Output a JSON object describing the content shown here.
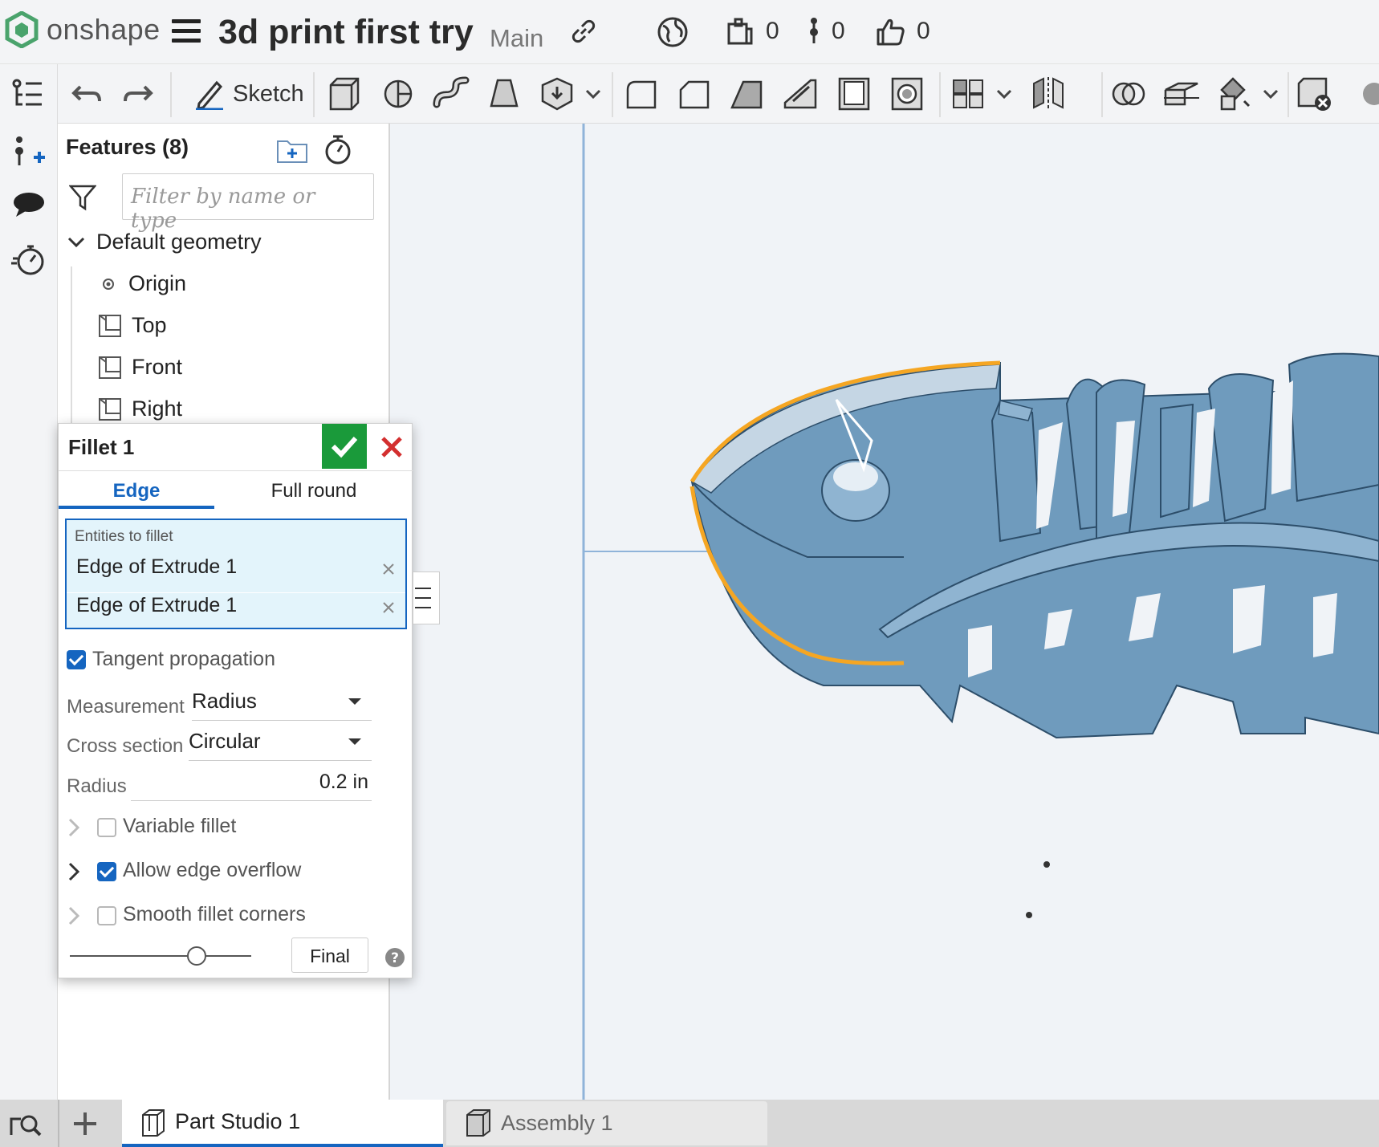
{
  "brand": {
    "name": "onshape",
    "color": "#4aa36c"
  },
  "document": {
    "title": "3d print first try",
    "branch": "Main"
  },
  "counters": {
    "versions": "0",
    "branches": "0",
    "likes": "0"
  },
  "toolbar": {
    "sketch_label": "Sketch"
  },
  "features": {
    "title": "Features (8)",
    "filter_placeholder": "Filter by name or type",
    "default_geometry": "Default geometry",
    "items": [
      "Origin",
      "Top",
      "Front",
      "Right"
    ]
  },
  "fillet": {
    "title": "Fillet 1",
    "tabs": [
      "Edge",
      "Full round"
    ],
    "entities_label": "Entities to fillet",
    "entities": [
      "Edge of Extrude 1",
      "Edge of Extrude 1"
    ],
    "tangent_propagation": "Tangent propagation",
    "measurement_label": "Measurement",
    "measurement_value": "Radius",
    "cross_section_label": "Cross section",
    "cross_section_value": "Circular",
    "radius_label": "Radius",
    "radius_value": "0.2 in",
    "variable_fillet": "Variable fillet",
    "allow_edge_overflow": "Allow edge overflow",
    "smooth_fillet_corners": "Smooth fillet corners",
    "final_button": "Final",
    "slider_fraction": 0.7
  },
  "tabs": {
    "part_studio": "Part Studio 1",
    "assembly": "Assembly 1"
  },
  "colors": {
    "accent": "#1565c0",
    "confirm": "#1a9a3a",
    "cancel": "#d32f2f",
    "model": "#6f9bbd",
    "highlight": "#f5a623"
  }
}
